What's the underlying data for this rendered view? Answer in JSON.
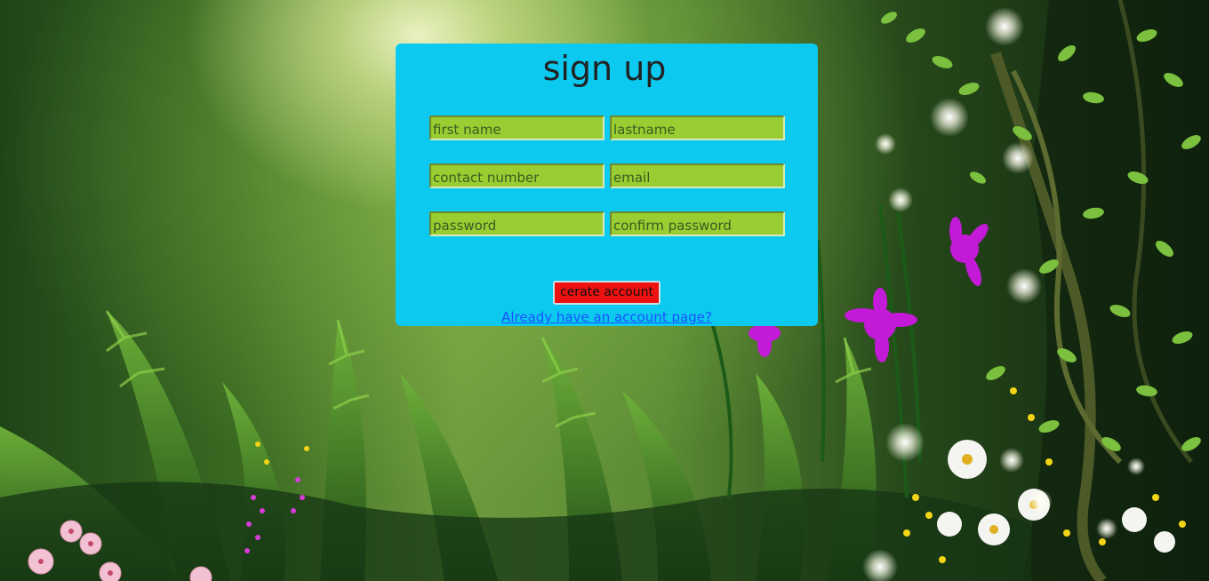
{
  "form": {
    "title": "sign up",
    "fields": {
      "first_name_placeholder": "first name",
      "lastname_placeholder": "lastname",
      "contact_placeholder": "contact number",
      "email_placeholder": "email",
      "password_placeholder": "password",
      "confirm_password_placeholder": "confirm password"
    },
    "submit_label": "cerate account",
    "login_link": "Already have an account page?"
  },
  "colors": {
    "card": "#0bc9ef",
    "input": "#9acd32",
    "button": "#ee1111",
    "link": "#1a53ff"
  }
}
